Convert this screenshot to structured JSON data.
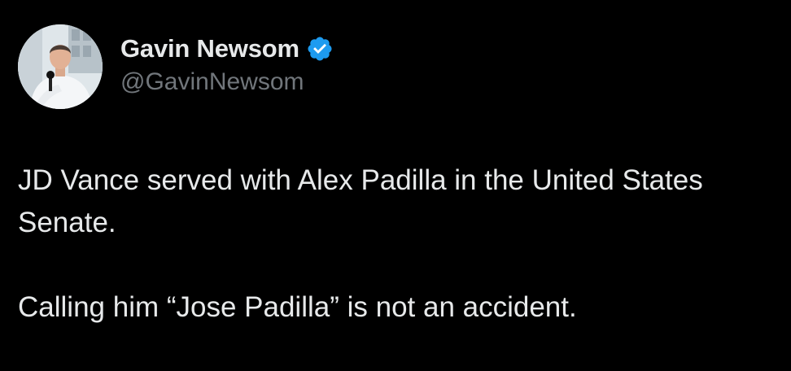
{
  "tweet": {
    "author": {
      "display_name": "Gavin Newsom",
      "handle": "@GavinNewsom",
      "verified": true,
      "verified_color": "#1d9bf0",
      "avatar_icon": "profile-photo"
    },
    "text": {
      "paragraph1": "JD Vance served with Alex Padilla in the United States Senate.",
      "paragraph2": "Calling him “Jose Padilla” is not an accident."
    }
  },
  "colors": {
    "background": "#000000",
    "primary_text": "#e7e9ea",
    "secondary_text": "#71767b",
    "verified_badge": "#1d9bf0"
  }
}
